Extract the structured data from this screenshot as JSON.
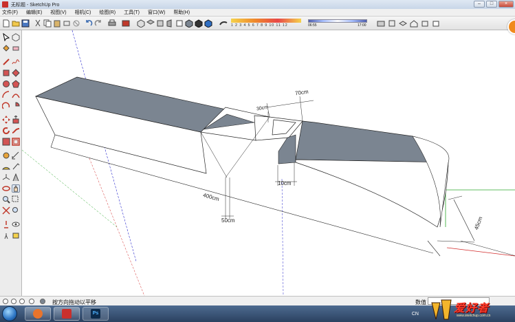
{
  "window": {
    "title": "无标题 - SketchUp Pro",
    "minimize": "–",
    "maximize": "□",
    "close": "×"
  },
  "menu": [
    "文件(F)",
    "编辑(E)",
    "视图(V)",
    "相机(C)",
    "绘图(R)",
    "工具(T)",
    "窗口(W)",
    "帮助(H)"
  ],
  "shadow_settings": {
    "months_label": "1 2 3 4 5 6 7 8 9 10 11 12",
    "time_start": "06:55",
    "time_mid": "中午",
    "time_end": "17:00"
  },
  "dimensions": {
    "length": "400cm",
    "width": "70cm",
    "depth_a": "30cm",
    "offset_a": "10cm",
    "offset_b": "50cm",
    "height": "45cm"
  },
  "status": {
    "hint": "按方向拖动以平移",
    "measure_label": "数值",
    "measure_value": ""
  },
  "taskbar": {
    "ime": "CN"
  },
  "watermark": {
    "brand": "爱好者",
    "site": "www.sketchup.com.cn"
  },
  "colors": {
    "model_gray": "#7b8591",
    "axis_green": "#2aa62a",
    "axis_red": "#d22a2a",
    "axis_blue": "#2a2acd"
  }
}
